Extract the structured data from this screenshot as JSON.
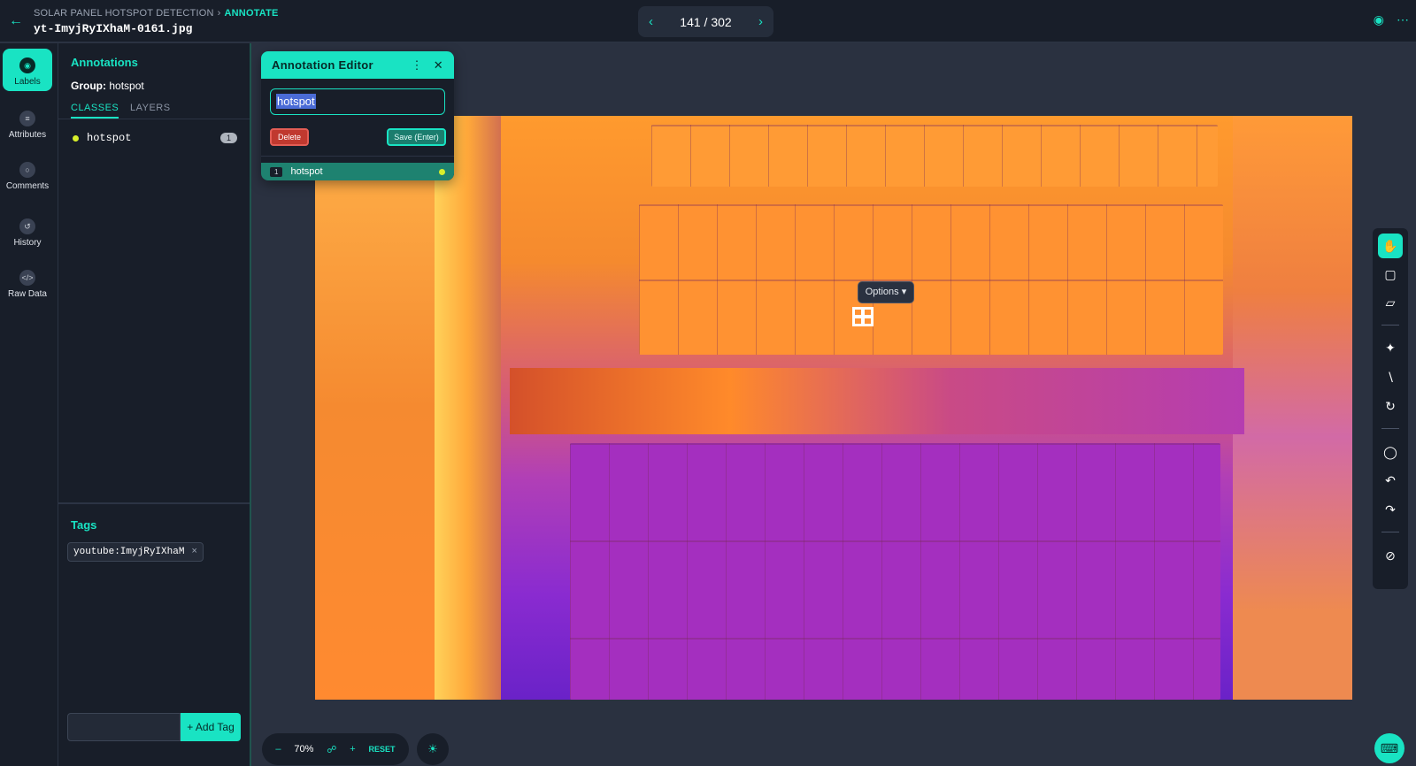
{
  "header": {
    "breadcrumb_project": "SOLAR PANEL HOTSPOT DETECTION",
    "breadcrumb_current": "ANNOTATE",
    "filename": "yt-ImyjRyIXhaM-0161.jpg",
    "pager": "141 / 302"
  },
  "rail": {
    "labels": "Labels",
    "attributes": "Attributes",
    "comments": "Comments",
    "history": "History",
    "raw_data": "Raw Data"
  },
  "panel": {
    "title": "Annotations",
    "group_label": "Group:",
    "group_value": "hotspot",
    "tab_classes": "CLASSES",
    "tab_layers": "LAYERS",
    "class_name": "hotspot",
    "class_count": "1"
  },
  "tags": {
    "title": "Tags",
    "chip": "youtube:ImyjRyIXhaM",
    "add_button": "+ Add Tag"
  },
  "editor": {
    "title": "Annotation Editor",
    "input_value": "hotspot",
    "delete": "Delete",
    "save": "Save (Enter)",
    "row_number": "1",
    "row_label": "hotspot"
  },
  "canvas": {
    "options": "Options"
  },
  "zoom": {
    "value": "70%",
    "reset": "RESET"
  },
  "colors": {
    "accent": "#19e3c3",
    "class_dot": "#d8ef2b",
    "delete": "#c0392f"
  }
}
